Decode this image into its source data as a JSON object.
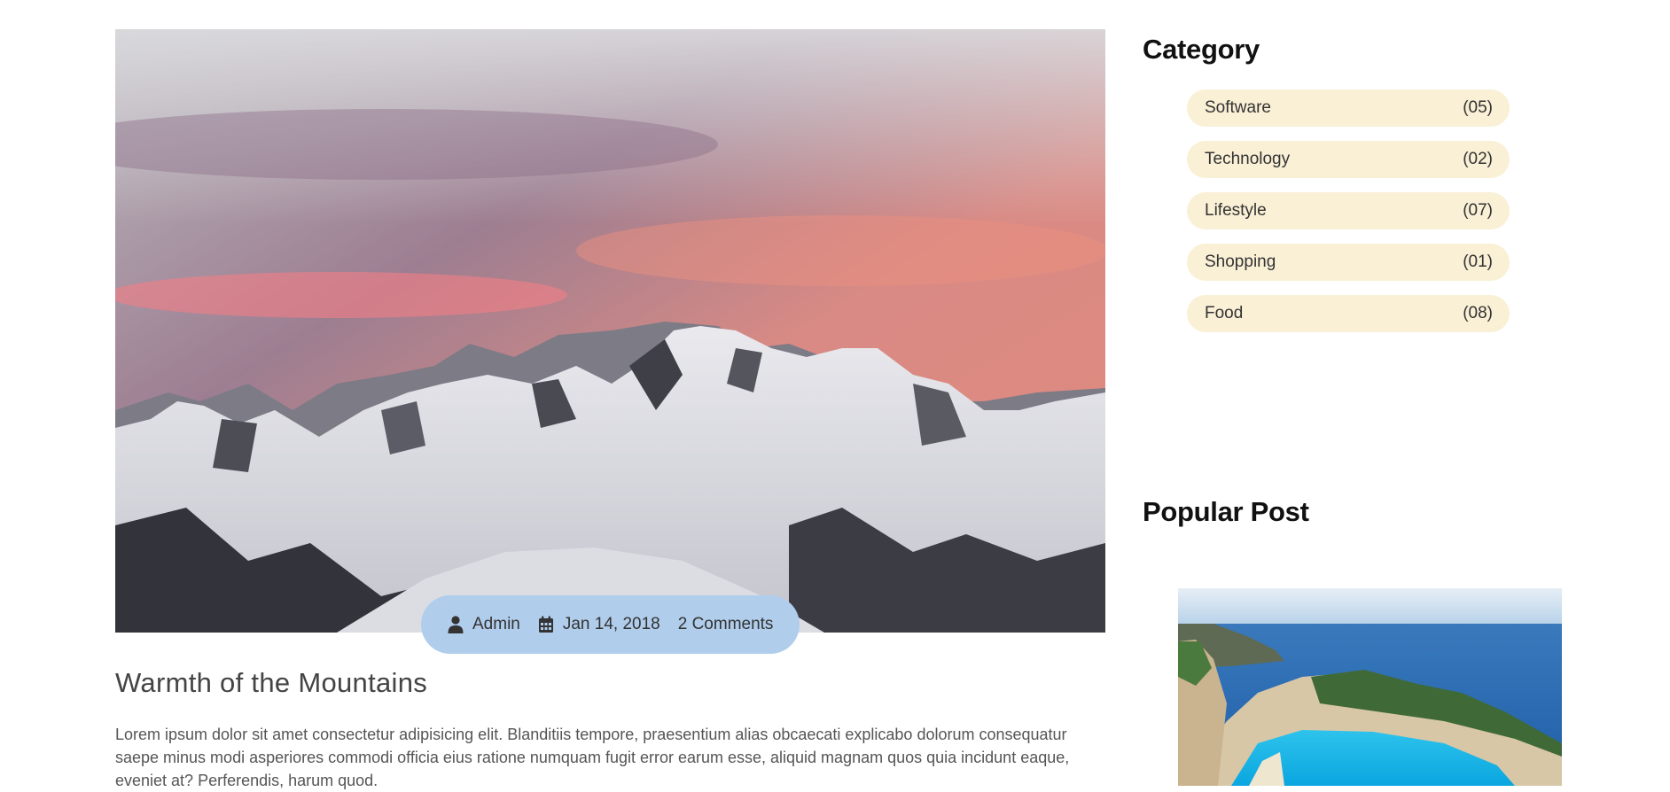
{
  "post": {
    "image_alt": "Snowy mountain range under a pink sunset sky",
    "author": "Admin",
    "date": "Jan 14, 2018",
    "comments": "2 Comments",
    "title": "Warmth of the Mountains",
    "excerpt": "Lorem ipsum dolor sit amet consectetur adipisicing elit. Blanditiis tempore, praesentium alias obcaecati explicabo dolorum consequatur saepe minus modi asperiores commodi officia eius ratione numquam fugit error earum esse, aliquid magnam quos quia incidunt eaque, eveniet at? Perferendis, harum quod."
  },
  "sidebar": {
    "category_heading": "Category",
    "categories": [
      {
        "label": "Software",
        "count": "(05)"
      },
      {
        "label": "Technology",
        "count": "(02)"
      },
      {
        "label": "Lifestyle",
        "count": "(07)"
      },
      {
        "label": "Shopping",
        "count": "(01)"
      },
      {
        "label": "Food",
        "count": "(08)"
      }
    ],
    "popular_heading": "Popular Post",
    "popular_image_alt": "Aerial view of a coastal cove with turquoise water"
  },
  "icons": {
    "author": "user-icon",
    "date": "calendar-icon"
  },
  "colors": {
    "meta_pill": "#b0cdec",
    "category_pill": "#faf0d6"
  }
}
